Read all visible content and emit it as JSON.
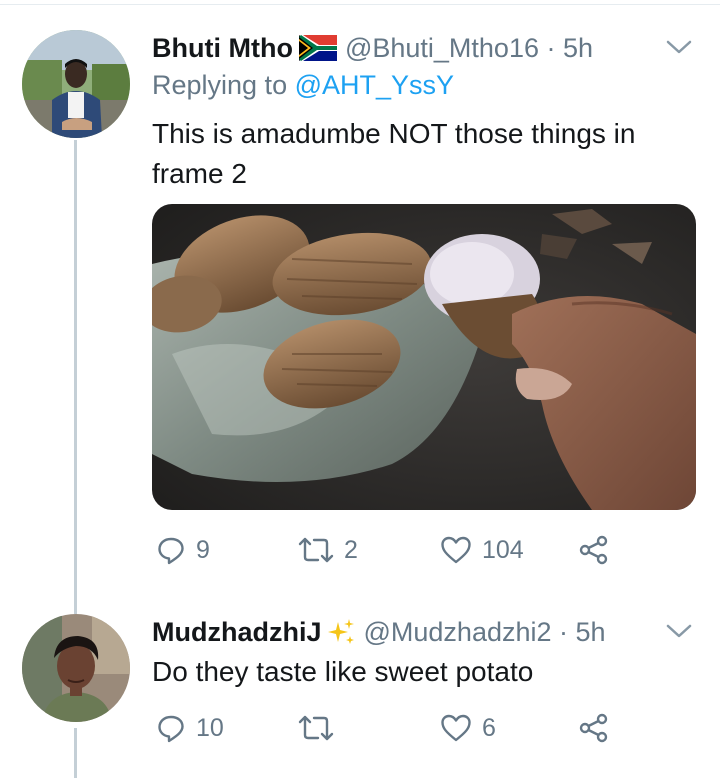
{
  "tweets": [
    {
      "name": "Bhuti Mtho",
      "flag": "south-africa-flag-icon",
      "handle": "@Bhuti_Mtho16 · 5h",
      "reply_prefix": "Replying to ",
      "reply_to": "@AHT_YssY",
      "text_line1": "This is amadumbe NOT those things in",
      "text_line2": "frame 2",
      "replies": "9",
      "retweets": "2",
      "likes": "104"
    },
    {
      "name": "MudzhadzhiJ",
      "badge": "sparkles-icon",
      "handle": "@Mudzhadzhi2 · 5h",
      "text_line1": "Do they taste like sweet potato",
      "replies": "10",
      "retweets": "",
      "likes": "6"
    }
  ],
  "colors": {
    "text": "#14171a",
    "secondary": "#657786",
    "link": "#1da1f2",
    "thread_line": "#c4cfd6"
  }
}
